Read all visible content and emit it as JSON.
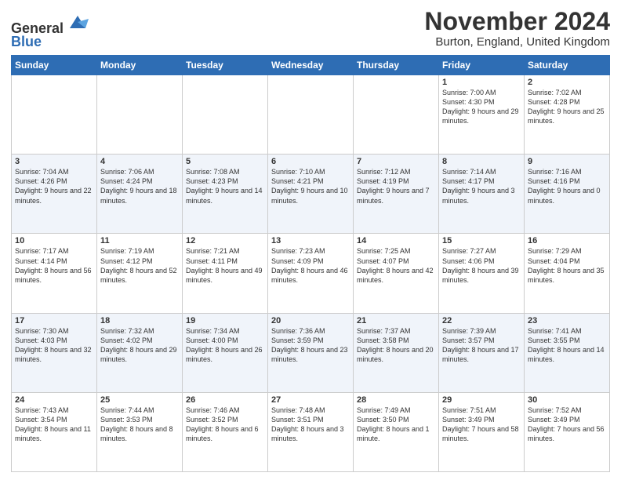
{
  "logo": {
    "general": "General",
    "blue": "Blue"
  },
  "title": "November 2024",
  "location": "Burton, England, United Kingdom",
  "days": [
    "Sunday",
    "Monday",
    "Tuesday",
    "Wednesday",
    "Thursday",
    "Friday",
    "Saturday"
  ],
  "weeks": [
    [
      {
        "day": "",
        "text": ""
      },
      {
        "day": "",
        "text": ""
      },
      {
        "day": "",
        "text": ""
      },
      {
        "day": "",
        "text": ""
      },
      {
        "day": "",
        "text": ""
      },
      {
        "day": "1",
        "text": "Sunrise: 7:00 AM\nSunset: 4:30 PM\nDaylight: 9 hours and 29 minutes."
      },
      {
        "day": "2",
        "text": "Sunrise: 7:02 AM\nSunset: 4:28 PM\nDaylight: 9 hours and 25 minutes."
      }
    ],
    [
      {
        "day": "3",
        "text": "Sunrise: 7:04 AM\nSunset: 4:26 PM\nDaylight: 9 hours and 22 minutes."
      },
      {
        "day": "4",
        "text": "Sunrise: 7:06 AM\nSunset: 4:24 PM\nDaylight: 9 hours and 18 minutes."
      },
      {
        "day": "5",
        "text": "Sunrise: 7:08 AM\nSunset: 4:23 PM\nDaylight: 9 hours and 14 minutes."
      },
      {
        "day": "6",
        "text": "Sunrise: 7:10 AM\nSunset: 4:21 PM\nDaylight: 9 hours and 10 minutes."
      },
      {
        "day": "7",
        "text": "Sunrise: 7:12 AM\nSunset: 4:19 PM\nDaylight: 9 hours and 7 minutes."
      },
      {
        "day": "8",
        "text": "Sunrise: 7:14 AM\nSunset: 4:17 PM\nDaylight: 9 hours and 3 minutes."
      },
      {
        "day": "9",
        "text": "Sunrise: 7:16 AM\nSunset: 4:16 PM\nDaylight: 9 hours and 0 minutes."
      }
    ],
    [
      {
        "day": "10",
        "text": "Sunrise: 7:17 AM\nSunset: 4:14 PM\nDaylight: 8 hours and 56 minutes."
      },
      {
        "day": "11",
        "text": "Sunrise: 7:19 AM\nSunset: 4:12 PM\nDaylight: 8 hours and 52 minutes."
      },
      {
        "day": "12",
        "text": "Sunrise: 7:21 AM\nSunset: 4:11 PM\nDaylight: 8 hours and 49 minutes."
      },
      {
        "day": "13",
        "text": "Sunrise: 7:23 AM\nSunset: 4:09 PM\nDaylight: 8 hours and 46 minutes."
      },
      {
        "day": "14",
        "text": "Sunrise: 7:25 AM\nSunset: 4:07 PM\nDaylight: 8 hours and 42 minutes."
      },
      {
        "day": "15",
        "text": "Sunrise: 7:27 AM\nSunset: 4:06 PM\nDaylight: 8 hours and 39 minutes."
      },
      {
        "day": "16",
        "text": "Sunrise: 7:29 AM\nSunset: 4:04 PM\nDaylight: 8 hours and 35 minutes."
      }
    ],
    [
      {
        "day": "17",
        "text": "Sunrise: 7:30 AM\nSunset: 4:03 PM\nDaylight: 8 hours and 32 minutes."
      },
      {
        "day": "18",
        "text": "Sunrise: 7:32 AM\nSunset: 4:02 PM\nDaylight: 8 hours and 29 minutes."
      },
      {
        "day": "19",
        "text": "Sunrise: 7:34 AM\nSunset: 4:00 PM\nDaylight: 8 hours and 26 minutes."
      },
      {
        "day": "20",
        "text": "Sunrise: 7:36 AM\nSunset: 3:59 PM\nDaylight: 8 hours and 23 minutes."
      },
      {
        "day": "21",
        "text": "Sunrise: 7:37 AM\nSunset: 3:58 PM\nDaylight: 8 hours and 20 minutes."
      },
      {
        "day": "22",
        "text": "Sunrise: 7:39 AM\nSunset: 3:57 PM\nDaylight: 8 hours and 17 minutes."
      },
      {
        "day": "23",
        "text": "Sunrise: 7:41 AM\nSunset: 3:55 PM\nDaylight: 8 hours and 14 minutes."
      }
    ],
    [
      {
        "day": "24",
        "text": "Sunrise: 7:43 AM\nSunset: 3:54 PM\nDaylight: 8 hours and 11 minutes."
      },
      {
        "day": "25",
        "text": "Sunrise: 7:44 AM\nSunset: 3:53 PM\nDaylight: 8 hours and 8 minutes."
      },
      {
        "day": "26",
        "text": "Sunrise: 7:46 AM\nSunset: 3:52 PM\nDaylight: 8 hours and 6 minutes."
      },
      {
        "day": "27",
        "text": "Sunrise: 7:48 AM\nSunset: 3:51 PM\nDaylight: 8 hours and 3 minutes."
      },
      {
        "day": "28",
        "text": "Sunrise: 7:49 AM\nSunset: 3:50 PM\nDaylight: 8 hours and 1 minute."
      },
      {
        "day": "29",
        "text": "Sunrise: 7:51 AM\nSunset: 3:49 PM\nDaylight: 7 hours and 58 minutes."
      },
      {
        "day": "30",
        "text": "Sunrise: 7:52 AM\nSunset: 3:49 PM\nDaylight: 7 hours and 56 minutes."
      }
    ]
  ]
}
